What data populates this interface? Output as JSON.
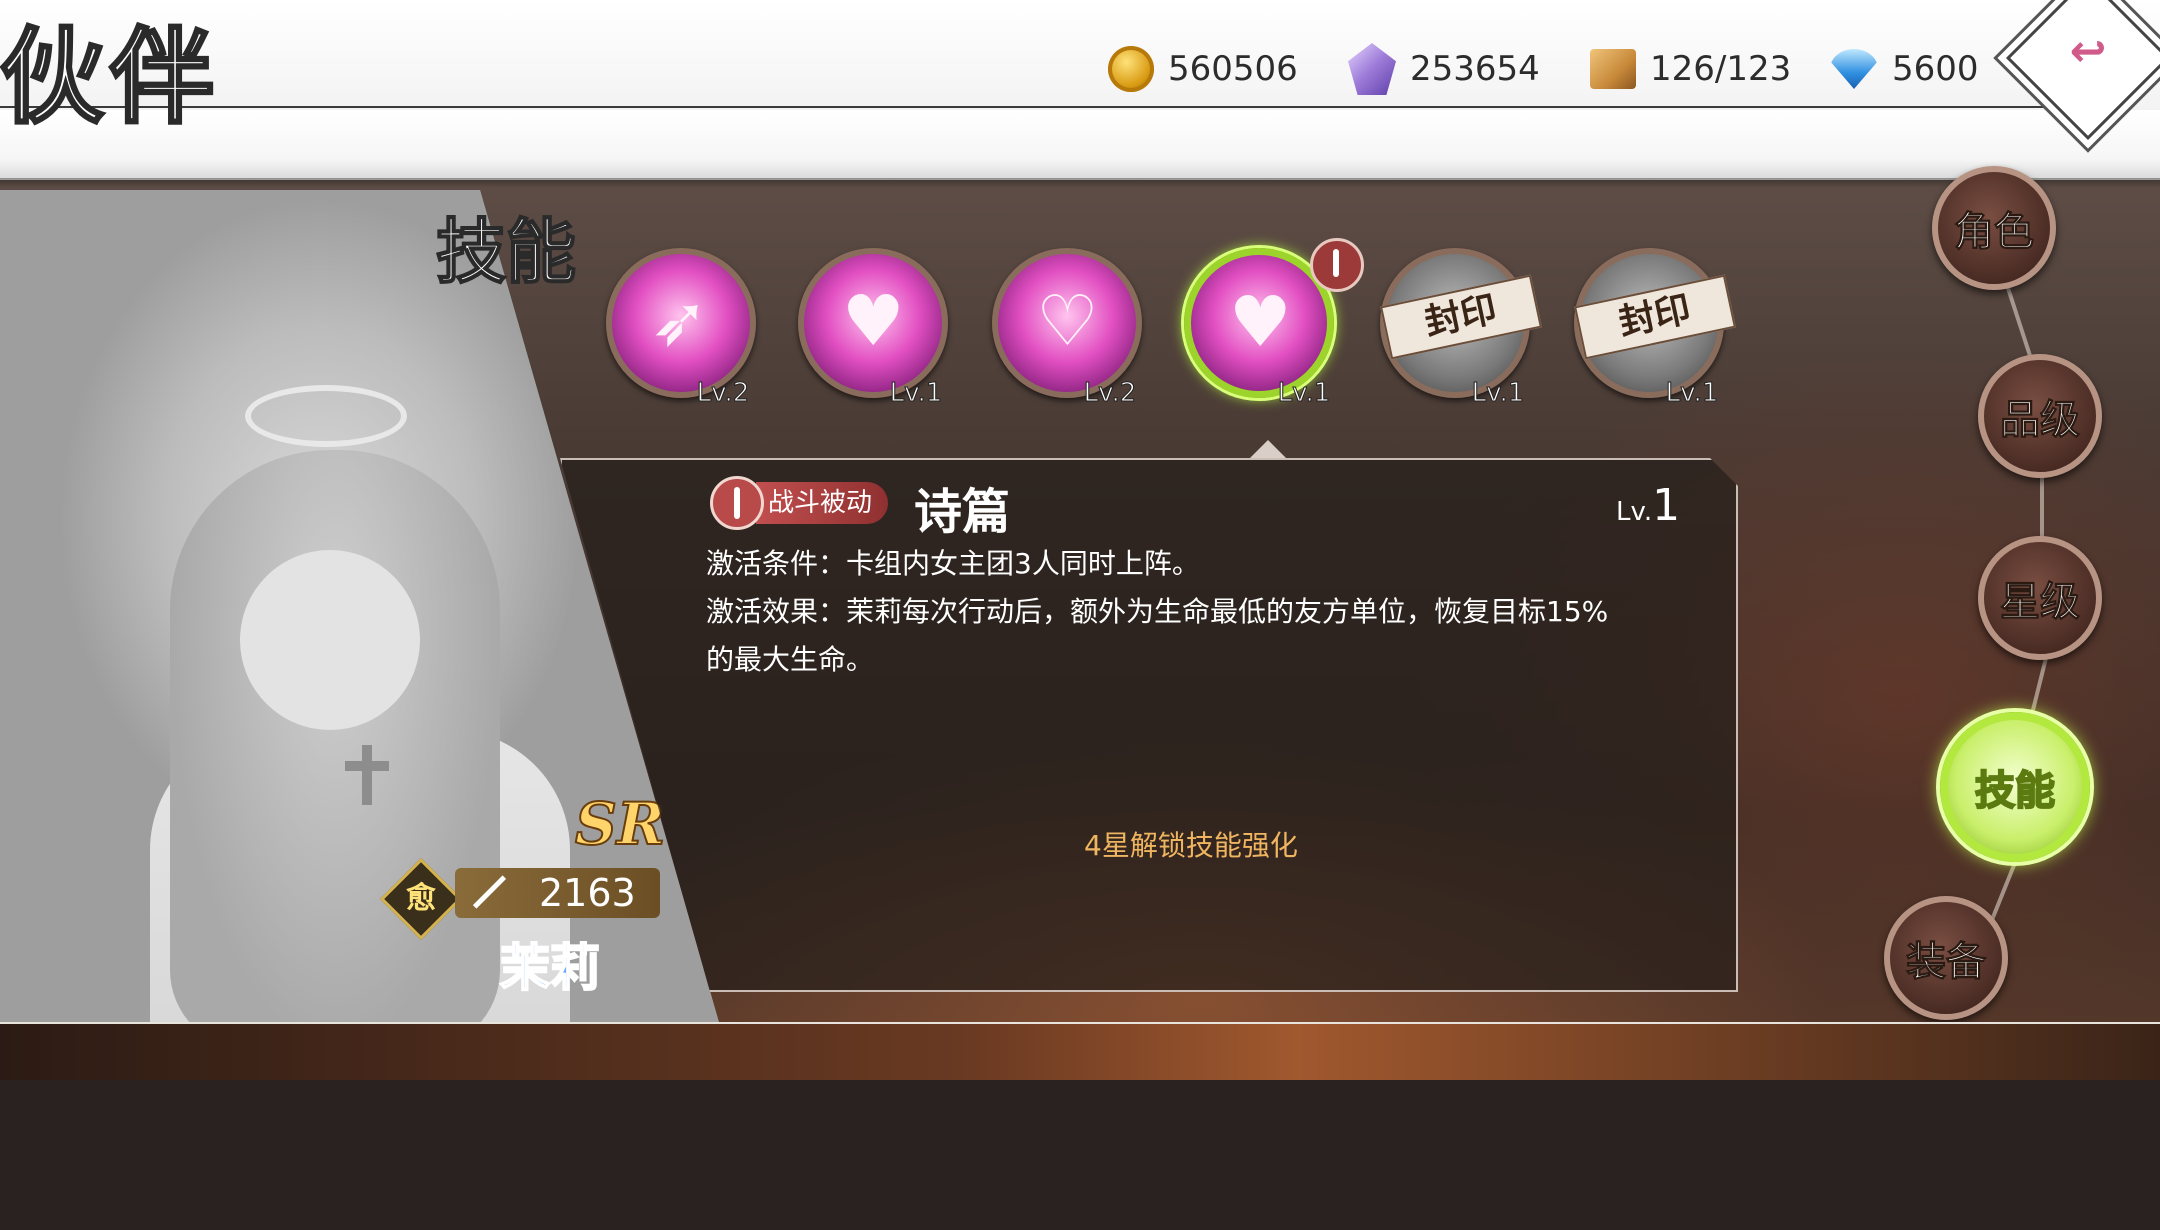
{
  "header": {
    "title": "伙伴"
  },
  "currencies": [
    {
      "icon": "gold-coin-icon",
      "value": "560506"
    },
    {
      "icon": "crystal-icon",
      "value": "253654"
    },
    {
      "icon": "inventory-box-icon",
      "value": "126/123"
    },
    {
      "icon": "diamond-icon",
      "value": "5600"
    }
  ],
  "panel": {
    "heading": "技能"
  },
  "character": {
    "rarity": "SR",
    "class_label": "愈",
    "power": "2163",
    "name": "茉莉"
  },
  "skills": [
    {
      "level": "Lv.2",
      "state": "unlocked"
    },
    {
      "level": "Lv.1",
      "state": "unlocked"
    },
    {
      "level": "Lv.2",
      "state": "unlocked"
    },
    {
      "level": "Lv.1",
      "state": "selected"
    },
    {
      "level": "Lv.1",
      "state": "sealed",
      "seal_label": "封印"
    },
    {
      "level": "Lv.1",
      "state": "sealed",
      "seal_label": "封印"
    }
  ],
  "detail": {
    "type_label": "战斗被动",
    "name": "诗篇",
    "level_prefix": "Lv.",
    "level_value": "1",
    "condition": "激活条件：卡组内女主团3人同时上阵。",
    "effect_line1": "激活效果：茉莉每次行动后，额外为生命最低的友方单位，恢复目标15%",
    "effect_line2": "的最大生命。",
    "unlock_note": "4星解锁技能强化"
  },
  "nav": {
    "items": [
      "角色",
      "品级",
      "星级",
      "技能",
      "装备"
    ],
    "active": "技能"
  },
  "colors": {
    "accent_green": "#b3e83f",
    "unlock_note": "#f0b560",
    "name_blue": "#6aa8ff"
  }
}
